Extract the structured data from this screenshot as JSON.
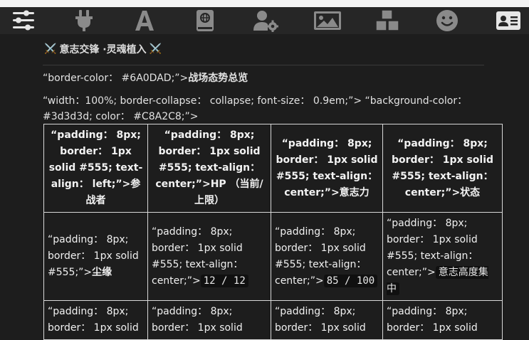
{
  "toolbar": {
    "icons": [
      "sliders-icon",
      "plug-icon",
      "font-icon",
      "book-icon",
      "user-cog-icon",
      "image-icon",
      "cubes-icon",
      "smile-icon",
      "id-card-icon"
    ]
  },
  "header": {
    "title": "意志交锋 ·灵魂植入",
    "left_emoji": "⚔️",
    "right_emoji": "⚔️"
  },
  "text": {
    "line1_prefix": "“border-color： #6A0DAD;”>",
    "line1_bold": "战场态势总览",
    "line2": "“width：100%; border-collapse： collapse; font-size： 0.9em;”> “background-color： #3d3d3d; color： #C8A2C8;”>"
  },
  "table": {
    "headers": [
      "“padding： 8px; border： 1px solid #555; text-align： left;”>参战者",
      "“padding： 8px; border： 1px solid #555; text-align： center;”>HP （当前/上限）",
      "“padding： 8px; border： 1px solid #555; text-align： center;”>意志力",
      "“padding： 8px; border： 1px solid #555; text-align： center;”>状态"
    ],
    "row1": {
      "c1_prefix": "“padding： 8px; border： 1px solid #555;”>",
      "c1_name": "尘缘",
      "c2_prefix": "“padding： 8px; border： 1px solid #555; text-align： center;”>",
      "c2_code": "12 / 12",
      "c3_prefix": "“padding： 8px; border： 1px solid #555; text-align： center;”>",
      "c3_code": "85 / 100",
      "c4_prefix": "“padding： 8px; border： 1px solid #555; text-align： center;”>",
      "c4_code": "意志高度集中"
    },
    "row2": {
      "c1": "“padding： 8px; border： 1px solid",
      "c2": "“padding： 8px; border： 1px solid",
      "c3": "“padding： 8px; border： 1px solid",
      "c4": "“padding： 8px; border： 1px solid"
    }
  }
}
